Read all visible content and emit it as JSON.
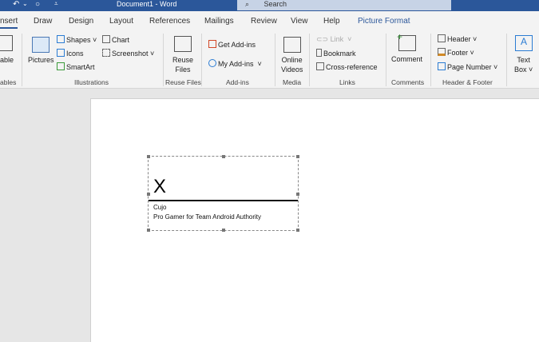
{
  "titlebar": {
    "title": "Document1  -  Word",
    "search_placeholder": "Search",
    "quick_access": [
      "↶",
      "⌄",
      "○",
      "⩡"
    ]
  },
  "tabs": [
    "nsert",
    "Draw",
    "Design",
    "Layout",
    "References",
    "Mailings",
    "Review",
    "View",
    "Help",
    "Picture Format"
  ],
  "ribbon": {
    "tables": {
      "label1": "able",
      "group": "ables"
    },
    "illustrations": {
      "pictures": "Pictures",
      "shapes": "Shapes ˅",
      "icons": "Icons",
      "smartart": "SmartArt",
      "chart": "Chart",
      "screenshot": "Screenshot ˅",
      "group": "Illustrations"
    },
    "reuse": {
      "label1": "Reuse",
      "label2": "Files",
      "group": "Reuse Files"
    },
    "addins": {
      "get": "Get Add-ins",
      "my": "My Add-ins",
      "group": "Add-ins"
    },
    "media": {
      "label1": "Online",
      "label2": "Videos",
      "group": "Media"
    },
    "links": {
      "link": "Link",
      "bookmark": "Bookmark",
      "crossref": "Cross-reference",
      "group": "Links"
    },
    "comments": {
      "comment": "Comment",
      "group": "Comments"
    },
    "headerfooter": {
      "header": "Header ˅",
      "footer": "Footer ˅",
      "pagenumber": "Page Number ˅",
      "group": "Header & Footer"
    },
    "text": {
      "label1": "Text",
      "label2": "Box ˅"
    }
  },
  "document": {
    "signature_x": "X",
    "signer_name": "Cujo",
    "signer_title": "Pro Gamer for Team Android Authority"
  }
}
